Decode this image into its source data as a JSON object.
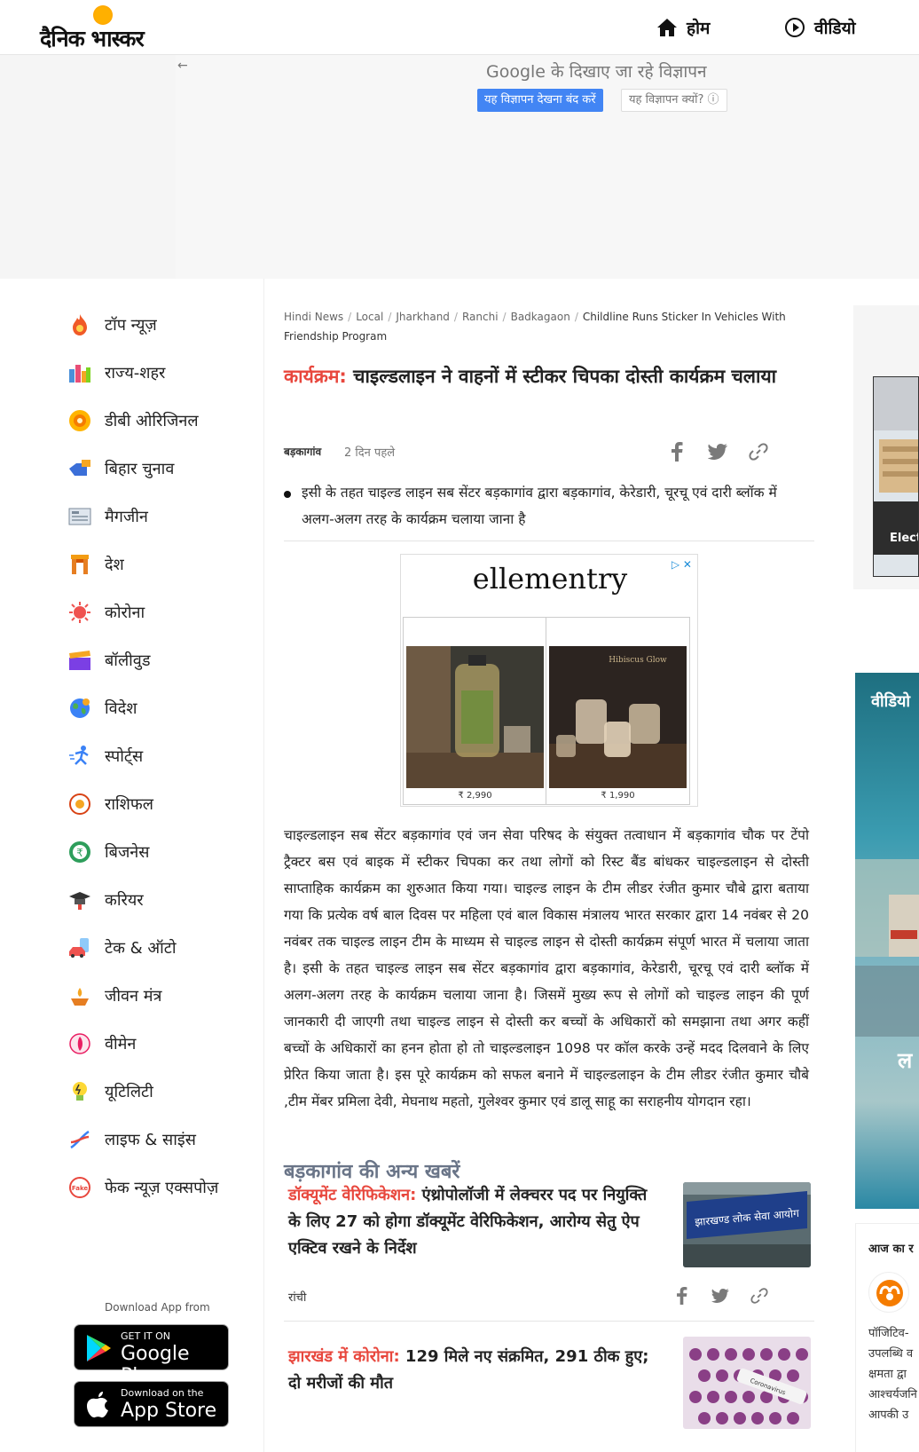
{
  "header": {
    "logo_text": "दैनिक भास्कर",
    "nav": [
      {
        "label": "होम",
        "icon": "home-icon"
      },
      {
        "label": "वीडियो",
        "icon": "play-circle-icon"
      }
    ]
  },
  "top_ad": {
    "back_arrow": "←",
    "google_text": "Google के दिखाए जा रहे विज्ञापन",
    "stop_label": "यह विज्ञापन देखना बंद करें",
    "why_label": "यह विज्ञापन क्यों? ⓘ"
  },
  "sidebar": {
    "items": [
      {
        "label": "टॉप न्यूज़",
        "icon": "flame-icon"
      },
      {
        "label": "राज्य-शहर",
        "icon": "city-icon"
      },
      {
        "label": "डीबी ओरिजिनल",
        "icon": "db-original-icon"
      },
      {
        "label": "बिहार चुनाव",
        "icon": "hand-vote-icon"
      },
      {
        "label": "मैगजीन",
        "icon": "magazine-icon"
      },
      {
        "label": "देश",
        "icon": "india-gate-icon"
      },
      {
        "label": "कोरोना",
        "icon": "virus-icon"
      },
      {
        "label": "बॉलीवुड",
        "icon": "clapperboard-icon"
      },
      {
        "label": "विदेश",
        "icon": "globe-icon"
      },
      {
        "label": "स्पोर्ट्स",
        "icon": "runner-icon"
      },
      {
        "label": "राशिफल",
        "icon": "zodiac-icon"
      },
      {
        "label": "बिजनेस",
        "icon": "rupee-icon"
      },
      {
        "label": "करियर",
        "icon": "graduation-cap-icon"
      },
      {
        "label": "टेक & ऑटो",
        "icon": "car-phone-icon"
      },
      {
        "label": "जीवन मंत्र",
        "icon": "diya-icon"
      },
      {
        "label": "वीमेन",
        "icon": "woman-icon"
      },
      {
        "label": "यूटिलिटी",
        "icon": "bulb-icon"
      },
      {
        "label": "लाइफ & साइंस",
        "icon": "dna-icon"
      },
      {
        "label": "फेक न्यूज़ एक्सपोज़",
        "icon": "fake-stamp-icon"
      }
    ],
    "download_label": "Download App from",
    "google_play": {
      "small": "GET IT ON",
      "big": "Google Play"
    },
    "app_store": {
      "small": "Download on the",
      "big": "App Store"
    }
  },
  "article": {
    "breadcrumb": [
      "Hindi News",
      "Local",
      "Jharkhand",
      "Ranchi",
      "Badkagaon"
    ],
    "breadcrumb_current": "Childline Runs Sticker In Vehicles With Friendship Program",
    "kicker": "कार्यक्रम:",
    "title": " चाइल्डलाइन ने वाहनों में स्टीकर चिपका दोस्ती कार्यक्रम चलाया",
    "location": "बड़कागांव",
    "time": "2 दिन पहले",
    "bullet": "इसी के तहत चाइल्ड लाइन सब सेंटर बड़कागांव द्वारा बड़कागांव, केरेडारी, चूरचू एवं दारी ब्लॉक में अलग-अलग तरह के कार्यक्रम चलाया जाना है",
    "body": "चाइल्डलाइन सब सेंटर बड़कागांव एवं जन सेवा परिषद के संयुक्त तत्वाधान में बड़कागांव चौक पर टेंपो ट्रैक्टर बस एवं बाइक में स्टीकर चिपका कर तथा लोगों को रिस्ट बैंड बांधकर चाइल्डलाइन से दोस्ती साप्ताहिक कार्यक्रम का शुरुआत किया गया। चाइल्ड लाइन के टीम लीडर रंजीत कुमार चौबे द्वारा बताया गया कि प्रत्येक वर्ष बाल दिवस पर महिला एवं बाल विकास मंत्रालय भारत सरकार द्वारा 14 नवंबर से 20 नवंबर तक चाइल्ड लाइन टीम के माध्यम से चाइल्ड लाइन से दोस्ती कार्यक्रम संपूर्ण भारत में चलाया जाता है। इसी के तहत चाइल्ड लाइन सब सेंटर बड़कागांव द्वारा बड़कागांव, केरेडारी, चूरचू एवं दारी ब्लॉक में अलग-अलग तरह के कार्यक्रम चलाया जाना है। जिसमें मुख्य रूप से लोगों को चाइल्ड लाइन की पूर्ण जानकारी दी जाएगी तथा चाइल्ड लाइन से दोस्ती कर बच्चों के अधिकारों को समझाना तथा अगर कहीं बच्चों के अधिकारों का हनन होता हो तो चाइल्डलाइन 1098 पर कॉल करके उन्हें मदद दिलवाने के लिए प्रेरित किया जाता है।    इस पूरे कार्यक्रम को सफल बनाने में चाइल्डलाइन के टीम लीडर रंजीत कुमार चौबे ,टीम मेंबर प्रमिला देवी, मेघनाथ महतो, गुलेश्वर कुमार एवं डालू साहू का सराहनीय योगदान रहा।"
  },
  "inline_ad": {
    "brand": "ellementry",
    "choices": "▷ ✕",
    "products": [
      {
        "price": "₹ 2,990"
      },
      {
        "price": "₹ 1,990",
        "label": "Hibiscus Glow"
      }
    ]
  },
  "more_news": {
    "title": "बड़कागांव की अन्य खबरें",
    "cards": [
      {
        "kicker": "डॉक्यूमेंट वेरिफिकेशन:",
        "title": " एंथ्रोपोलॉजी में लेक्चरर पद पर नियुक्ति के लिए 27 को होगा डॉक्यूमेंट वेरिफिकेशन, आरोग्य सेतु ऐप एक्टिव रखने के निर्देश",
        "location": "रांची",
        "image_text": "झारखण्ड लोक सेवा आयोग"
      },
      {
        "kicker": "झारखंड में कोरोना:",
        "title": " 129 मिले नए संक्रमित, 291 ठीक हुए; दो मरीजों की मौत",
        "location": "",
        "image_text": "Coronavirus"
      }
    ]
  },
  "right_rail": {
    "thumb_caption": "Elect",
    "video_title": "वीडियो",
    "video_big": "ल",
    "horoscope_title": "आज का र",
    "horoscope_text": [
      "पॉजिटिव-",
      "उपलब्धि व",
      "क्षमता द्वा",
      "आश्चर्यजनि",
      "आपकी उ"
    ]
  },
  "colors": {
    "accent_red": "#e8473d",
    "ad_blue": "#4285f4",
    "more_title_gray": "#6a7588"
  }
}
